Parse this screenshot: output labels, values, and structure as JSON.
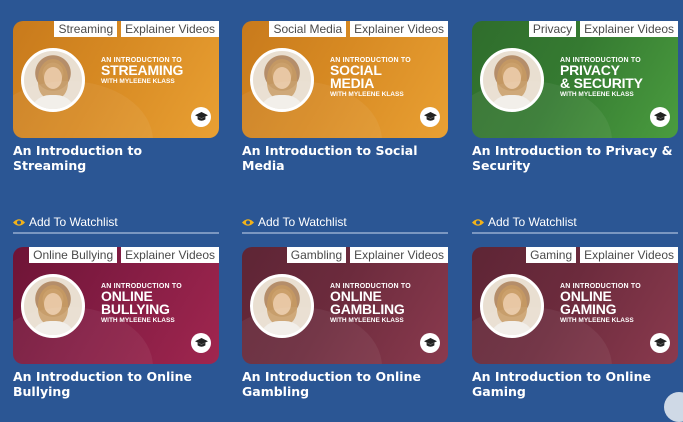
{
  "watchlist_label": "Add To Watchlist",
  "cards": [
    {
      "tags": [
        "Streaming",
        "Explainer Videos"
      ],
      "thumb_top": "AN INTRODUCTION TO",
      "thumb_big": [
        "STREAMING"
      ],
      "thumb_with": "WITH MYLEENE KLASS",
      "title": "An Introduction to Streaming",
      "theme": "orange"
    },
    {
      "tags": [
        "Social Media",
        "Explainer Videos"
      ],
      "thumb_top": "AN INTRODUCTION TO",
      "thumb_big": [
        "SOCIAL",
        "MEDIA"
      ],
      "thumb_with": "WITH MYLEENE KLASS",
      "title": "An Introduction to Social Media",
      "theme": "orange"
    },
    {
      "tags": [
        "Privacy",
        "Explainer Videos"
      ],
      "thumb_top": "AN INTRODUCTION TO",
      "thumb_big": [
        "PRIVACY",
        "& SECURITY"
      ],
      "thumb_with": "WITH MYLEENE KLASS",
      "title": "An Introduction to Privacy & Security",
      "theme": "green"
    },
    {
      "tags": [
        "Online Bullying",
        "Explainer Videos"
      ],
      "thumb_top": "AN INTRODUCTION TO",
      "thumb_big": [
        "ONLINE",
        "BULLYING"
      ],
      "thumb_with": "WITH MYLEENE KLASS",
      "title": "An Introduction to Online Bullying",
      "theme": "crimson"
    },
    {
      "tags": [
        "Gambling",
        "Explainer Videos"
      ],
      "thumb_top": "AN INTRODUCTION TO",
      "thumb_big": [
        "ONLINE",
        "GAMBLING"
      ],
      "thumb_with": "WITH MYLEENE KLASS",
      "title": "An Introduction to Online Gambling",
      "theme": "plum"
    },
    {
      "tags": [
        "Gaming",
        "Explainer Videos"
      ],
      "thumb_top": "AN INTRODUCTION TO",
      "thumb_big": [
        "ONLINE",
        "GAMING"
      ],
      "thumb_with": "WITH MYLEENE KLASS",
      "title": "An Introduction to Online Gaming",
      "theme": "plum"
    }
  ],
  "colors": {
    "page_bg": "#2b5694",
    "eye_icon": "#f2b21a",
    "orange": "#d78a23",
    "green": "#357a31",
    "crimson": "#831c43",
    "plum": "#6c2b3d"
  },
  "icons": {
    "watch": "eye-icon",
    "course": "graduation-cap-icon"
  }
}
